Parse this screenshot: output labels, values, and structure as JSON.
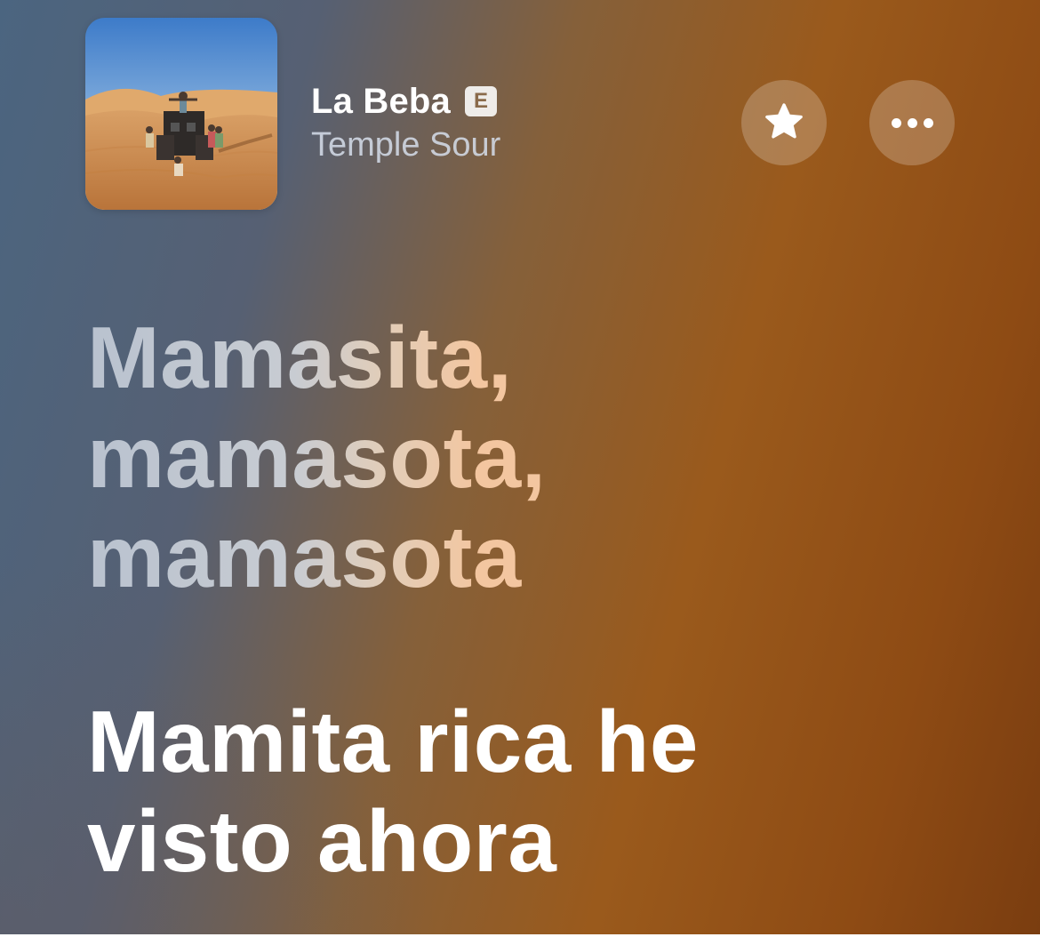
{
  "player": {
    "track": {
      "title": "La Beba",
      "explicit_badge": "E",
      "artist": "Temple Sour"
    },
    "actions": {
      "favorite_icon": "star-icon",
      "more_icon": "ellipsis-icon"
    }
  },
  "lyrics": {
    "past": [
      "Mamasita,",
      "mamasota,",
      "mamasota"
    ],
    "current": [
      "Mamita rica he",
      "visto ahora"
    ]
  },
  "colors": {
    "background_left": "#4b6580",
    "background_right": "#8e4b14",
    "current_lyric": "#ffffff"
  }
}
